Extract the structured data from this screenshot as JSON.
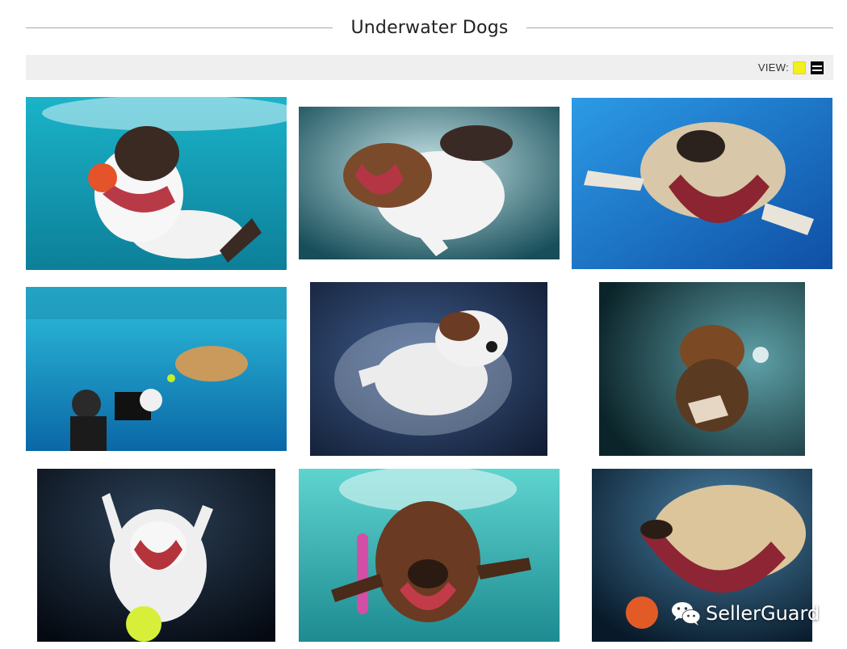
{
  "header": {
    "title": "Underwater Dogs"
  },
  "toolbar": {
    "view_label": "VIEW:",
    "view_options": [
      {
        "icon": "grid-view-icon",
        "color": "#f4ef1e",
        "selected": true
      },
      {
        "icon": "list-view-icon",
        "color": "#000000",
        "selected": false
      }
    ]
  },
  "gallery": {
    "photos": [
      {
        "icon": "dog-photo-spaniel-red-ball",
        "colors": [
          "#1ab3c8",
          "#0d7f99"
        ]
      },
      {
        "icon": "dog-photo-spaniel-brown-white",
        "colors": [
          "#2f8a93",
          "#174e5a"
        ]
      },
      {
        "icon": "dog-photo-labrador-blue",
        "colors": [
          "#1f86d6",
          "#0f4fa5"
        ]
      },
      {
        "icon": "dog-photo-pool-diver",
        "colors": [
          "#24b5d8",
          "#0a67a6"
        ]
      },
      {
        "icon": "dog-photo-white-brown-dark",
        "colors": [
          "#2a3e63",
          "#121d33"
        ]
      },
      {
        "icon": "dog-photo-brindle-teal",
        "colors": [
          "#17434a",
          "#0b2429"
        ]
      },
      {
        "icon": "dog-photo-pitbull-tennis-ball",
        "colors": [
          "#1a2433",
          "#050a12"
        ]
      },
      {
        "icon": "dog-photo-chocolate-lab-toy",
        "colors": [
          "#47c2c0",
          "#1d8b91"
        ]
      },
      {
        "icon": "dog-photo-yellow-lab-orange-ball",
        "colors": [
          "#1c3f5a",
          "#081a2a"
        ]
      }
    ]
  },
  "watermark": {
    "text": "SellerGuard",
    "icon": "wechat-logo-icon"
  }
}
